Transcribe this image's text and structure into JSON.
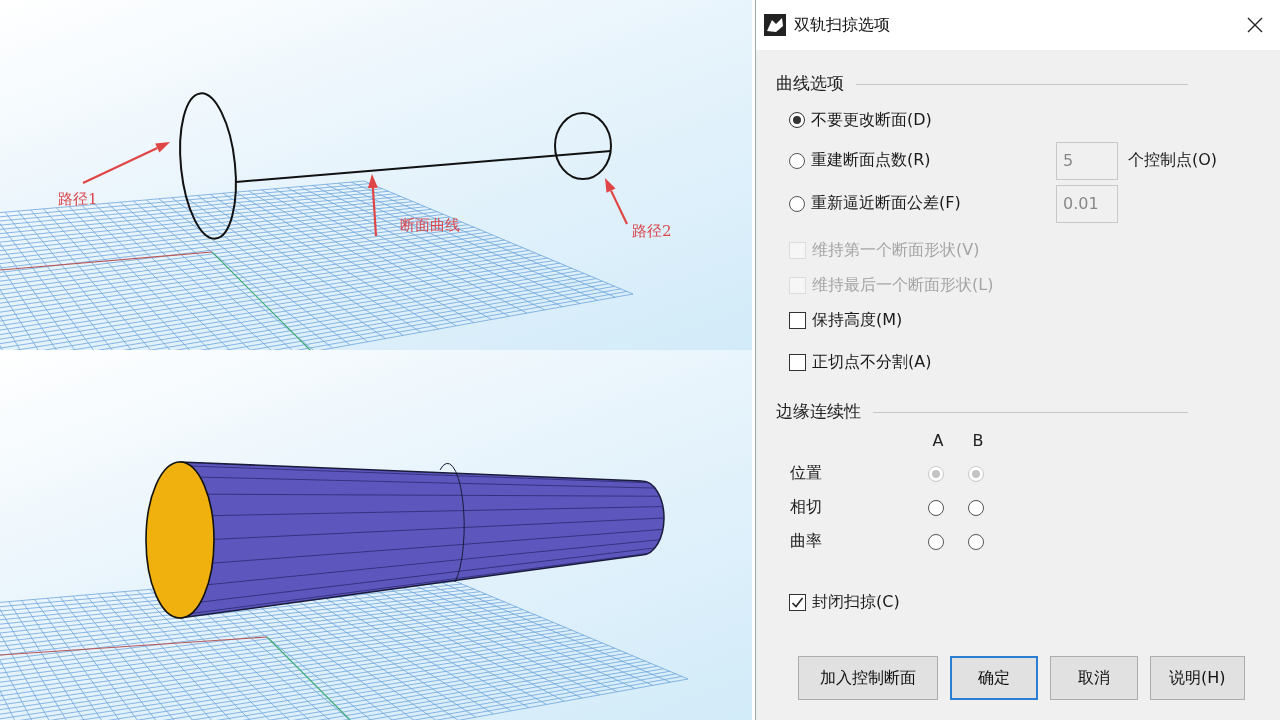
{
  "viewports": [
    {
      "kind": "curves",
      "labels": [
        {
          "text": "路径1"
        },
        {
          "text": "断面曲线"
        },
        {
          "text": "路径2"
        }
      ]
    },
    {
      "kind": "surface"
    }
  ],
  "dialog": {
    "title": "双轨扫掠选项",
    "curve_options": {
      "heading": "曲线选项",
      "options": [
        {
          "label": "不要更改断面(D)",
          "selected": true
        },
        {
          "label": "重建断面点数(R)",
          "selected": false,
          "field": {
            "value": "5"
          },
          "suffix": "个控制点(O)"
        },
        {
          "label": "重新逼近断面公差(F)",
          "selected": false,
          "field": {
            "value": "0.01"
          }
        }
      ],
      "checkboxes": [
        {
          "label": "维持第一个断面形状(V)",
          "checked": false,
          "disabled": true
        },
        {
          "label": "维持最后一个断面形状(L)",
          "checked": false,
          "disabled": true
        },
        {
          "label": "保持高度(M)",
          "checked": false,
          "disabled": false
        },
        {
          "label": "正切点不分割(A)",
          "checked": false,
          "disabled": false
        }
      ]
    },
    "edge_continuity": {
      "heading": "边缘连续性",
      "columns": [
        "A",
        "B"
      ],
      "rows": [
        {
          "label": "位置",
          "radios": [
            {
              "selected": true,
              "disabled": true
            },
            {
              "selected": true,
              "disabled": true
            }
          ]
        },
        {
          "label": "相切",
          "radios": [
            {
              "selected": false,
              "disabled": false
            },
            {
              "selected": false,
              "disabled": false
            }
          ]
        },
        {
          "label": "曲率",
          "radios": [
            {
              "selected": false,
              "disabled": false
            },
            {
              "selected": false,
              "disabled": false
            }
          ]
        }
      ]
    },
    "close_sweep": {
      "label": "封闭扫掠(C)",
      "checked": true
    },
    "buttons": [
      {
        "label": "加入控制断面",
        "default": false
      },
      {
        "label": "确定",
        "default": true
      },
      {
        "label": "取消",
        "default": false
      },
      {
        "label": "说明(H)",
        "default": false
      }
    ]
  }
}
